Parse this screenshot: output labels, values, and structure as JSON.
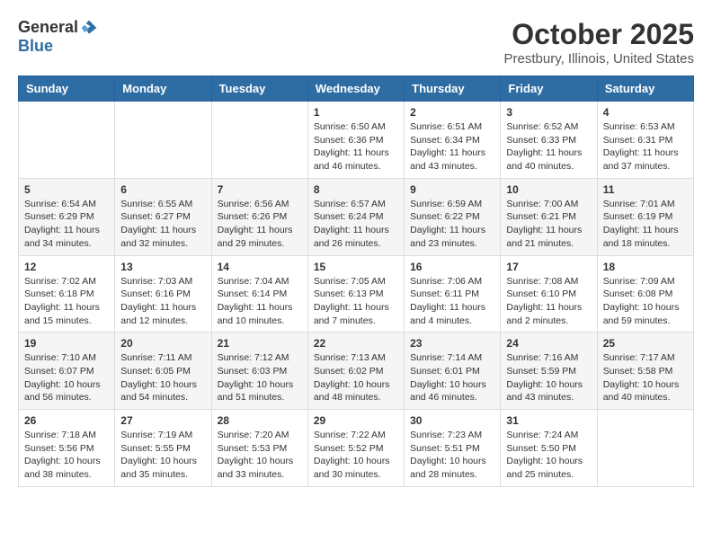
{
  "logo": {
    "general": "General",
    "blue": "Blue"
  },
  "title": "October 2025",
  "location": "Prestbury, Illinois, United States",
  "days_of_week": [
    "Sunday",
    "Monday",
    "Tuesday",
    "Wednesday",
    "Thursday",
    "Friday",
    "Saturday"
  ],
  "weeks": [
    [
      {
        "day": "",
        "info": ""
      },
      {
        "day": "",
        "info": ""
      },
      {
        "day": "",
        "info": ""
      },
      {
        "day": "1",
        "info": "Sunrise: 6:50 AM\nSunset: 6:36 PM\nDaylight: 11 hours and 46 minutes."
      },
      {
        "day": "2",
        "info": "Sunrise: 6:51 AM\nSunset: 6:34 PM\nDaylight: 11 hours and 43 minutes."
      },
      {
        "day": "3",
        "info": "Sunrise: 6:52 AM\nSunset: 6:33 PM\nDaylight: 11 hours and 40 minutes."
      },
      {
        "day": "4",
        "info": "Sunrise: 6:53 AM\nSunset: 6:31 PM\nDaylight: 11 hours and 37 minutes."
      }
    ],
    [
      {
        "day": "5",
        "info": "Sunrise: 6:54 AM\nSunset: 6:29 PM\nDaylight: 11 hours and 34 minutes."
      },
      {
        "day": "6",
        "info": "Sunrise: 6:55 AM\nSunset: 6:27 PM\nDaylight: 11 hours and 32 minutes."
      },
      {
        "day": "7",
        "info": "Sunrise: 6:56 AM\nSunset: 6:26 PM\nDaylight: 11 hours and 29 minutes."
      },
      {
        "day": "8",
        "info": "Sunrise: 6:57 AM\nSunset: 6:24 PM\nDaylight: 11 hours and 26 minutes."
      },
      {
        "day": "9",
        "info": "Sunrise: 6:59 AM\nSunset: 6:22 PM\nDaylight: 11 hours and 23 minutes."
      },
      {
        "day": "10",
        "info": "Sunrise: 7:00 AM\nSunset: 6:21 PM\nDaylight: 11 hours and 21 minutes."
      },
      {
        "day": "11",
        "info": "Sunrise: 7:01 AM\nSunset: 6:19 PM\nDaylight: 11 hours and 18 minutes."
      }
    ],
    [
      {
        "day": "12",
        "info": "Sunrise: 7:02 AM\nSunset: 6:18 PM\nDaylight: 11 hours and 15 minutes."
      },
      {
        "day": "13",
        "info": "Sunrise: 7:03 AM\nSunset: 6:16 PM\nDaylight: 11 hours and 12 minutes."
      },
      {
        "day": "14",
        "info": "Sunrise: 7:04 AM\nSunset: 6:14 PM\nDaylight: 11 hours and 10 minutes."
      },
      {
        "day": "15",
        "info": "Sunrise: 7:05 AM\nSunset: 6:13 PM\nDaylight: 11 hours and 7 minutes."
      },
      {
        "day": "16",
        "info": "Sunrise: 7:06 AM\nSunset: 6:11 PM\nDaylight: 11 hours and 4 minutes."
      },
      {
        "day": "17",
        "info": "Sunrise: 7:08 AM\nSunset: 6:10 PM\nDaylight: 11 hours and 2 minutes."
      },
      {
        "day": "18",
        "info": "Sunrise: 7:09 AM\nSunset: 6:08 PM\nDaylight: 10 hours and 59 minutes."
      }
    ],
    [
      {
        "day": "19",
        "info": "Sunrise: 7:10 AM\nSunset: 6:07 PM\nDaylight: 10 hours and 56 minutes."
      },
      {
        "day": "20",
        "info": "Sunrise: 7:11 AM\nSunset: 6:05 PM\nDaylight: 10 hours and 54 minutes."
      },
      {
        "day": "21",
        "info": "Sunrise: 7:12 AM\nSunset: 6:03 PM\nDaylight: 10 hours and 51 minutes."
      },
      {
        "day": "22",
        "info": "Sunrise: 7:13 AM\nSunset: 6:02 PM\nDaylight: 10 hours and 48 minutes."
      },
      {
        "day": "23",
        "info": "Sunrise: 7:14 AM\nSunset: 6:01 PM\nDaylight: 10 hours and 46 minutes."
      },
      {
        "day": "24",
        "info": "Sunrise: 7:16 AM\nSunset: 5:59 PM\nDaylight: 10 hours and 43 minutes."
      },
      {
        "day": "25",
        "info": "Sunrise: 7:17 AM\nSunset: 5:58 PM\nDaylight: 10 hours and 40 minutes."
      }
    ],
    [
      {
        "day": "26",
        "info": "Sunrise: 7:18 AM\nSunset: 5:56 PM\nDaylight: 10 hours and 38 minutes."
      },
      {
        "day": "27",
        "info": "Sunrise: 7:19 AM\nSunset: 5:55 PM\nDaylight: 10 hours and 35 minutes."
      },
      {
        "day": "28",
        "info": "Sunrise: 7:20 AM\nSunset: 5:53 PM\nDaylight: 10 hours and 33 minutes."
      },
      {
        "day": "29",
        "info": "Sunrise: 7:22 AM\nSunset: 5:52 PM\nDaylight: 10 hours and 30 minutes."
      },
      {
        "day": "30",
        "info": "Sunrise: 7:23 AM\nSunset: 5:51 PM\nDaylight: 10 hours and 28 minutes."
      },
      {
        "day": "31",
        "info": "Sunrise: 7:24 AM\nSunset: 5:50 PM\nDaylight: 10 hours and 25 minutes."
      },
      {
        "day": "",
        "info": ""
      }
    ]
  ]
}
